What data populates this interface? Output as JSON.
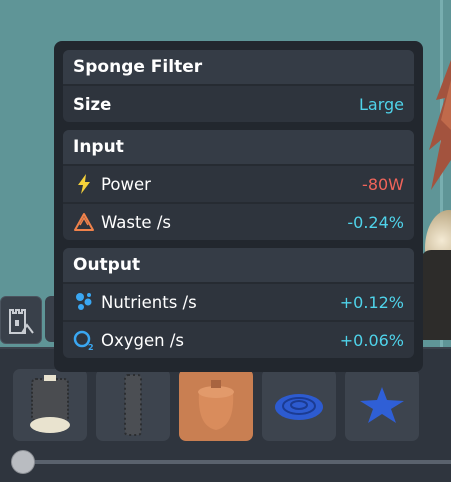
{
  "panel": {
    "title": "Sponge Filter",
    "size_label": "Size",
    "size_value": "Large",
    "input": {
      "heading": "Input",
      "rows": [
        {
          "icon": "lightning-icon",
          "label": "Power",
          "value": "-80W"
        },
        {
          "icon": "recycle-icon",
          "label": "Waste /s",
          "value": "-0.24%"
        }
      ]
    },
    "output": {
      "heading": "Output",
      "rows": [
        {
          "icon": "nutrients-icon",
          "label": "Nutrients /s",
          "value": "+0.12%"
        },
        {
          "icon": "oxygen-icon",
          "label": "Oxygen /s",
          "value": "+0.06%"
        }
      ]
    }
  },
  "colors": {
    "accent_cyan": "#4fd3ea",
    "negative_red": "#f0645a",
    "power_yellow": "#f6d23a",
    "waste_orange": "#f0824b",
    "oxygen_blue": "#3aa7f2",
    "selected_item": "#c97f52"
  },
  "drawer": {
    "items": [
      {
        "name": "sponge-filter-item",
        "selected": false
      },
      {
        "name": "tall-filter-item",
        "selected": false
      },
      {
        "name": "pot-item",
        "selected": true
      },
      {
        "name": "blue-shell-item",
        "selected": false
      },
      {
        "name": "blue-starfish-item",
        "selected": false
      }
    ],
    "scroll_position": 0
  }
}
